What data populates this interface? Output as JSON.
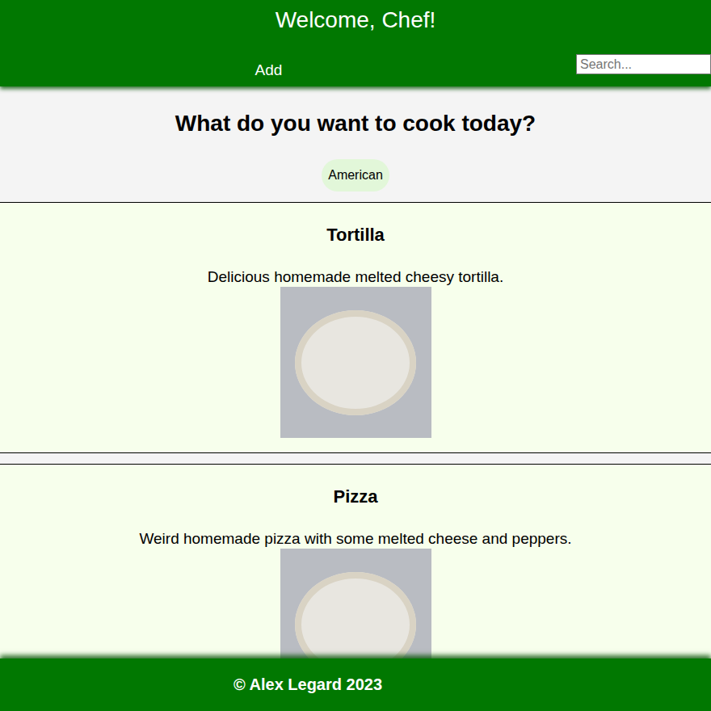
{
  "header": {
    "title": "Welcome, Chef!"
  },
  "nav": {
    "items": [
      {
        "label": "Add"
      }
    ]
  },
  "search": {
    "placeholder": "Search..."
  },
  "intro": {
    "heading": "What do you want to cook today?"
  },
  "categories": [
    {
      "label": "American"
    }
  ],
  "recipes": [
    {
      "title": "Tortilla",
      "description": "Delicious homemade melted cheesy tortilla."
    },
    {
      "title": "Pizza",
      "description": "Weird homemade pizza with some melted cheese and peppers."
    }
  ],
  "footer": {
    "text": "© Alex Legard 2023"
  }
}
